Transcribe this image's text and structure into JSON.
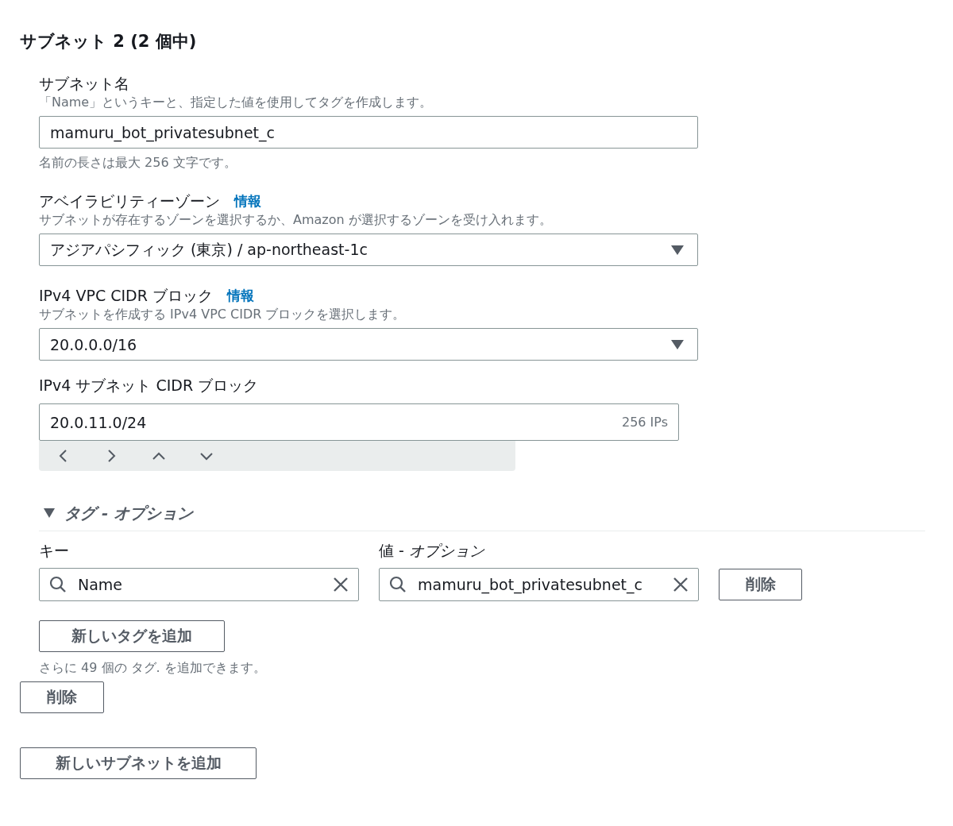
{
  "heading": "サブネット 2 (2 個中)",
  "fields": [
    {
      "kind": "text",
      "label": "サブネット名",
      "description": "「Name」というキーと、指定した値を使用してタグを作成します。",
      "value": "mamuru_bot_privatesubnet_c",
      "hint": "名前の長さは最大 256 文字です。"
    },
    {
      "kind": "select",
      "label": "アベイラビリティーゾーン",
      "info": "情報",
      "description": "サブネットが存在するゾーンを選択するか、Amazon が選択するゾーンを受け入れます。",
      "value": "アジアパシフィック (東京) / ap-northeast-1c"
    },
    {
      "kind": "select",
      "label": "IPv4 VPC CIDR ブロック",
      "info": "情報",
      "description": "サブネットを作成する IPv4 VPC CIDR ブロックを選択します。",
      "value": "20.0.0.0/16"
    },
    {
      "kind": "cidr",
      "label": "IPv4 サブネット CIDR ブロック",
      "value": "20.0.11.0/24",
      "suffix": "256 IPs"
    }
  ],
  "tags": {
    "title": "タグ - オプション",
    "expanded": true,
    "key_label": "キー",
    "value_label": "値 - *オプション*",
    "rows": [
      {
        "key": "Name",
        "value": "mamuru_bot_privatesubnet_c",
        "remove": "削除"
      }
    ],
    "add_button": "新しいタグを追加",
    "limit_note": "さらに 49 個の タグ. を追加できます。"
  },
  "remove_button": "削除",
  "add_subnet_button": "新しいサブネットを追加"
}
